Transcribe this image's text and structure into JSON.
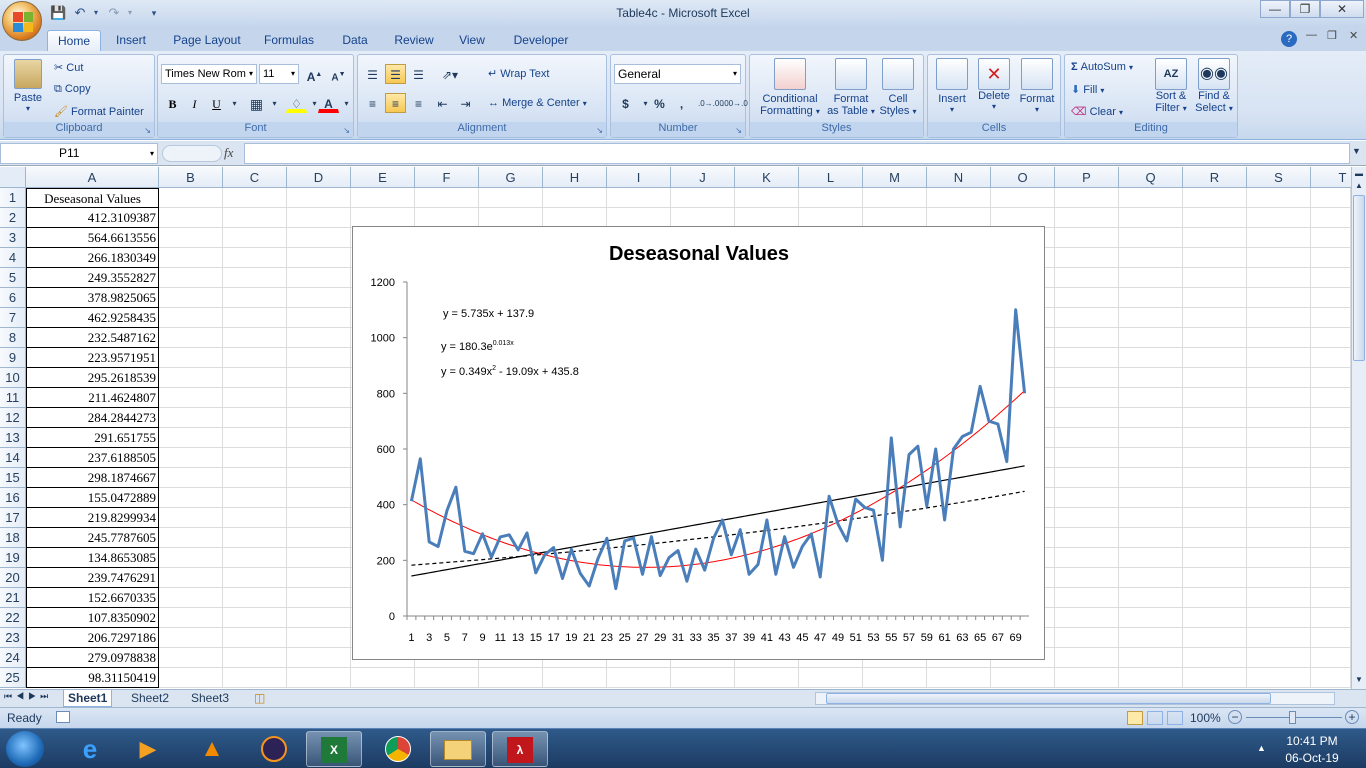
{
  "window": {
    "title": "Table4c - Microsoft Excel"
  },
  "tabs": [
    "Home",
    "Insert",
    "Page Layout",
    "Formulas",
    "Data",
    "Review",
    "View",
    "Developer"
  ],
  "ribbon": {
    "clipboard": {
      "label": "Clipboard",
      "paste": "Paste",
      "cut": "Cut",
      "copy": "Copy",
      "format_painter": "Format Painter"
    },
    "font": {
      "label": "Font",
      "font_name": "Times New Rom",
      "font_size": "11",
      "bold": "B",
      "italic": "I",
      "underline": "U"
    },
    "alignment": {
      "label": "Alignment",
      "wrap_text": "Wrap Text",
      "merge_center": "Merge & Center"
    },
    "number": {
      "label": "Number",
      "format": "General",
      "currency": "$",
      "percent": "%",
      "comma": ",",
      "inc_decimal": ".0→.00",
      "dec_decimal": ".00→.0"
    },
    "styles": {
      "label": "Styles",
      "conditional_1": "Conditional",
      "conditional_2": "Formatting",
      "format_table_1": "Format",
      "format_table_2": "as Table",
      "cell_styles_1": "Cell",
      "cell_styles_2": "Styles"
    },
    "cells": {
      "label": "Cells",
      "insert": "Insert",
      "delete": "Delete",
      "format": "Format"
    },
    "editing": {
      "label": "Editing",
      "autosum": "AutoSum",
      "fill": "Fill",
      "clear": "Clear",
      "sort_1": "Sort &",
      "sort_2": "Filter",
      "find_1": "Find &",
      "find_2": "Select"
    }
  },
  "formula_bar": {
    "name_box": "P11",
    "fx": "fx",
    "formula": ""
  },
  "columns": [
    "A",
    "B",
    "C",
    "D",
    "E",
    "F",
    "G",
    "H",
    "I",
    "J",
    "K",
    "L",
    "M",
    "N",
    "O",
    "P",
    "Q",
    "R",
    "S",
    "T"
  ],
  "rows": [
    {
      "n": "1",
      "a": "Deseasonal Values"
    },
    {
      "n": "2",
      "a": "412.3109387"
    },
    {
      "n": "3",
      "a": "564.6613556"
    },
    {
      "n": "4",
      "a": "266.1830349"
    },
    {
      "n": "5",
      "a": "249.3552827"
    },
    {
      "n": "6",
      "a": "378.9825065"
    },
    {
      "n": "7",
      "a": "462.9258435"
    },
    {
      "n": "8",
      "a": "232.5487162"
    },
    {
      "n": "9",
      "a": "223.9571951"
    },
    {
      "n": "10",
      "a": "295.2618539"
    },
    {
      "n": "11",
      "a": "211.4624807"
    },
    {
      "n": "12",
      "a": "284.2844273"
    },
    {
      "n": "13",
      "a": "291.651755"
    },
    {
      "n": "14",
      "a": "237.6188505"
    },
    {
      "n": "15",
      "a": "298.1874667"
    },
    {
      "n": "16",
      "a": "155.0472889"
    },
    {
      "n": "17",
      "a": "219.8299934"
    },
    {
      "n": "18",
      "a": "245.7787605"
    },
    {
      "n": "19",
      "a": "134.8653085"
    },
    {
      "n": "20",
      "a": "239.7476291"
    },
    {
      "n": "21",
      "a": "152.6670335"
    },
    {
      "n": "22",
      "a": "107.8350902"
    },
    {
      "n": "23",
      "a": "206.7297186"
    },
    {
      "n": "24",
      "a": "279.0978838"
    },
    {
      "n": "25",
      "a": "98.31150419"
    }
  ],
  "chart_data": {
    "type": "line",
    "title": "Deseasonal Values",
    "xlabel": "",
    "ylabel": "",
    "ylim": [
      0,
      1200
    ],
    "yticks": [
      0,
      200,
      400,
      600,
      800,
      1000,
      1200
    ],
    "xticks": [
      1,
      3,
      5,
      7,
      9,
      11,
      13,
      15,
      17,
      19,
      21,
      23,
      25,
      27,
      29,
      31,
      33,
      35,
      37,
      39,
      41,
      43,
      45,
      47,
      49,
      51,
      53,
      55,
      57,
      59,
      61,
      63,
      65,
      67,
      69
    ],
    "grid": false,
    "legend": "none",
    "x": [
      1,
      2,
      3,
      4,
      5,
      6,
      7,
      8,
      9,
      10,
      11,
      12,
      13,
      14,
      15,
      16,
      17,
      18,
      19,
      20,
      21,
      22,
      23,
      24,
      25,
      26,
      27,
      28,
      29,
      30,
      31,
      32,
      33,
      34,
      35,
      36,
      37,
      38,
      39,
      40,
      41,
      42,
      43,
      44,
      45,
      46,
      47,
      48,
      49,
      50,
      51,
      52,
      53,
      54,
      55,
      56,
      57,
      58,
      59,
      60,
      61,
      62,
      63,
      64,
      65,
      66,
      67,
      68,
      69,
      70
    ],
    "series": [
      {
        "values": [
          412.3,
          564.7,
          266.2,
          249.4,
          379.0,
          462.9,
          232.5,
          224.0,
          295.3,
          211.5,
          284.3,
          291.7,
          237.6,
          298.2,
          155.0,
          219.8,
          245.8,
          134.9,
          239.7,
          152.7,
          107.8,
          206.7,
          279.1,
          98.3,
          270,
          280,
          150,
          285,
          145,
          210,
          235,
          125,
          240,
          165,
          280,
          345,
          220,
          310,
          150,
          185,
          345,
          150,
          285,
          175,
          250,
          295,
          140,
          430,
          330,
          270,
          420,
          390,
          380,
          200,
          640,
          320,
          580,
          610,
          395,
          600,
          345,
          600,
          645,
          660,
          825,
          700,
          690,
          555,
          1100,
          800
        ],
        "color": "#4a7ebb"
      }
    ],
    "trendlines": [
      {
        "kind": "linear",
        "equation": "y = 5.735x + 137.9",
        "color": "#000000",
        "style": "solid"
      },
      {
        "kind": "exponential",
        "equation": "y = 180.3e",
        "exponent": "0.013x",
        "color": "#000000",
        "style": "dashed"
      },
      {
        "kind": "polynomial",
        "equation_a": "y = 0.349x",
        "sup": "2",
        "equation_b": " - 19.09x + 435.8",
        "color": "#ff0000",
        "style": "solid"
      }
    ]
  },
  "sheets": [
    "Sheet1",
    "Sheet2",
    "Sheet3"
  ],
  "status": {
    "ready": "Ready",
    "zoom": "100%"
  },
  "taskbar": {
    "time": "10:41 PM",
    "date": "06-Oct-19"
  }
}
